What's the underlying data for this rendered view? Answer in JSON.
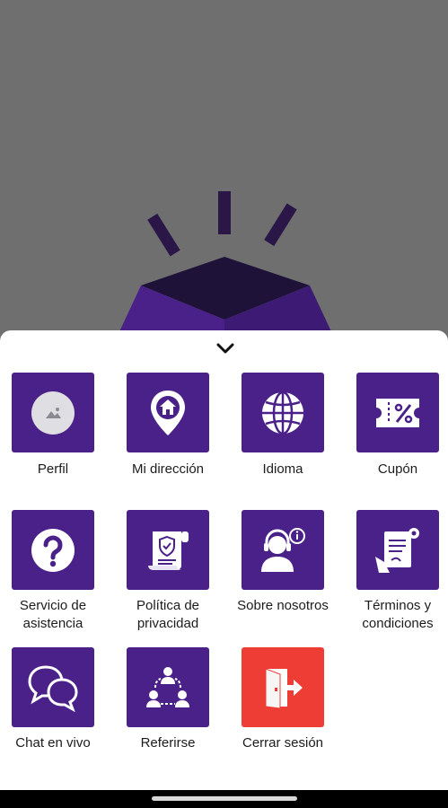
{
  "colors": {
    "tile": "#4a2189",
    "logout_tile": "#ee3d35",
    "label_text": "#1c1c1c",
    "backdrop": "#6f6f6f"
  },
  "background_illustration": "open-box-logo",
  "sheet": {
    "collapse_icon": "chevron-down-icon",
    "items": [
      {
        "label": "Perfil",
        "icon": "avatar-placeholder-icon"
      },
      {
        "label": "Mi dirección",
        "icon": "location-home-icon"
      },
      {
        "label": "Idioma",
        "icon": "globe-icon"
      },
      {
        "label": "Cupón",
        "icon": "coupon-icon"
      },
      {
        "label": "Servicio de\nasistencia",
        "icon": "question-icon"
      },
      {
        "label": "Política de\nprivacidad",
        "icon": "privacy-document-icon"
      },
      {
        "label": "Sobre nosotros",
        "icon": "support-agent-icon"
      },
      {
        "label": "Términos y\ncondiciones",
        "icon": "terms-document-icon"
      },
      {
        "label": "Chat en vivo",
        "icon": "chat-bubbles-icon"
      },
      {
        "label": "Referirse",
        "icon": "referral-network-icon"
      },
      {
        "label": "Cerrar sesión",
        "icon": "logout-door-icon"
      }
    ]
  }
}
